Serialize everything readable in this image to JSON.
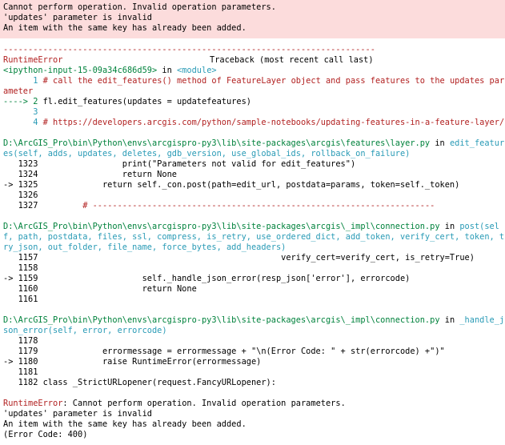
{
  "error_box": {
    "lines": [
      "Cannot perform operation. Invalid operation parameters.",
      "'updates' parameter is invalid",
      "An item with the same key has already been added."
    ]
  },
  "traceback": {
    "dashes": "---------------------------------------------------------------------------",
    "error_type": "RuntimeError",
    "header_right": "Traceback (most recent call last)",
    "input_ref": "<ipython-input-15-09a34c686d59>",
    "in_word": " in ",
    "module_ref": "<module>",
    "frame1": {
      "l1_no": "      1 ",
      "l1_code": "# call the edit_features() method of FeatureLayer object and pass features to the updates par",
      "l1_wrap": "ameter",
      "arrow2": "----> 2 ",
      "l2_code": "fl.edit_features(updates = updatefeatures)",
      "l3_no": "      3",
      "l4_no": "      4 ",
      "l4_code": "# https://developers.arcgis.com/python/sample-notebooks/updating-features-in-a-feature-layer/"
    },
    "frame2": {
      "path": "D:\\ArcGIS_Pro\\bin\\Python\\envs\\arcgispro-py3\\lib\\site-packages\\arcgis\\features\\layer.py",
      "func_a": "edit_featur",
      "func_b": "es(self, adds, updates, deletes, gdb_version, use_global_ids, rollback_on_failure)",
      "l1323": "   1323                 print(\"Parameters not valid for edit_features\")",
      "l1324": "   1324                 return None",
      "l1325": "-> 1325             return self._con.post(path=edit_url, postdata=params, token=self._token)",
      "l1326": "   1326",
      "l1327_no": "   1327 ",
      "l1327_code": "        # ---------------------------------------------------------------------"
    },
    "frame3": {
      "path": "D:\\ArcGIS_Pro\\bin\\Python\\envs\\arcgispro-py3\\lib\\site-packages\\arcgis\\_impl\\connection.py",
      "func_a": "post(sel",
      "func_b": "f, path, postdata, files, ssl, compress, is_retry, use_ordered_dict, add_token, verify_cert, token, t",
      "func_c": "ry_json, out_folder, file_name, force_bytes, add_headers)",
      "l1157": "   1157                                                 verify_cert=verify_cert, is_retry=True)",
      "l1158": "   1158",
      "l1159": "-> 1159                     self._handle_json_error(resp_json['error'], errorcode)",
      "l1160": "   1160                     return None",
      "l1161": "   1161"
    },
    "frame4": {
      "path": "D:\\ArcGIS_Pro\\bin\\Python\\envs\\arcgispro-py3\\lib\\site-packages\\arcgis\\_impl\\connection.py",
      "func_a": "_handle_j",
      "func_b": "son_error(self, error, errorcode)",
      "l1178": "   1178",
      "l1179": "   1179             errormessage = errormessage + \"\\n(Error Code: \" + str(errorcode) +\")\"",
      "l1180": "-> 1180             raise RuntimeError(errormessage)",
      "l1181": "   1181",
      "l1182": "   1182 class _StrictURLopener(request.FancyURLopener):"
    },
    "final": {
      "type": "RuntimeError",
      "msg1": ": Cannot perform operation. Invalid operation parameters.",
      "msg2": "'updates' parameter is invalid",
      "msg3": "An item with the same key has already been added.",
      "msg4": "(Error Code: 400)"
    }
  }
}
